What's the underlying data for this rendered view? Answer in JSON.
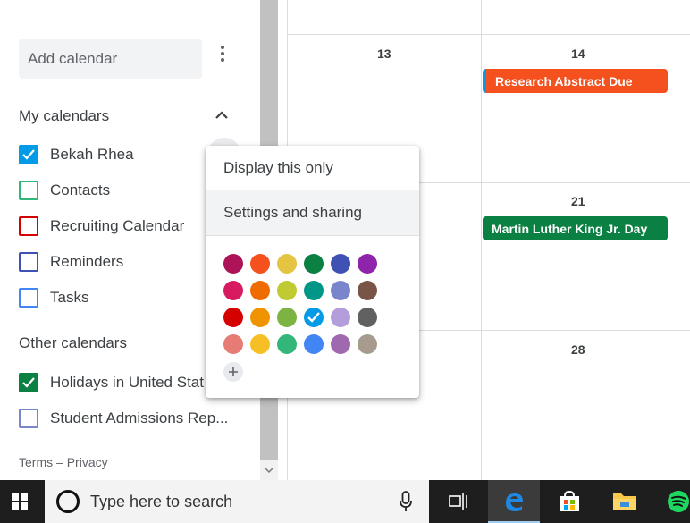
{
  "sidebar": {
    "add_calendar_placeholder": "Add calendar",
    "my_calendars_title": "My calendars",
    "my_calendars": [
      {
        "label": "Bekah Rhea",
        "color": "#039be5",
        "checked": true
      },
      {
        "label": "Contacts",
        "color": "#33b679",
        "checked": false
      },
      {
        "label": "Recruiting Calendar",
        "color": "#d50000",
        "checked": false
      },
      {
        "label": "Reminders",
        "color": "#3f51b5",
        "checked": false
      },
      {
        "label": "Tasks",
        "color": "#4285f4",
        "checked": false
      }
    ],
    "other_calendars_title": "Other calendars",
    "other_calendars": [
      {
        "label": "Holidays in United Stat",
        "color": "#0b8043",
        "checked": true
      },
      {
        "label": "Student Admissions Rep...",
        "color": "#7986cb",
        "checked": false
      }
    ],
    "footer_terms": "Terms",
    "footer_sep": "–",
    "footer_privacy": "Privacy"
  },
  "calendar": {
    "days": [
      {
        "num": "13"
      },
      {
        "num": "14"
      },
      {
        "num": "21"
      },
      {
        "num": "28"
      }
    ],
    "events": [
      {
        "title": "Research Abstract Due",
        "color": "#f4511e",
        "stripe": "#039be5"
      },
      {
        "title": "Martin Luther King Jr. Day",
        "color": "#0b8043"
      }
    ]
  },
  "popup": {
    "items": [
      {
        "label": "Display this only"
      },
      {
        "label": "Settings and sharing"
      }
    ],
    "colors": [
      [
        "#ad1457",
        "#f4511e",
        "#e4c441",
        "#0b8043",
        "#3f51b5",
        "#8e24aa"
      ],
      [
        "#d81b60",
        "#ef6c00",
        "#c0ca33",
        "#009688",
        "#7986cb",
        "#795548"
      ],
      [
        "#d50000",
        "#f09300",
        "#7cb342",
        "#039be5",
        "#b39ddb",
        "#616161"
      ],
      [
        "#e67c73",
        "#f6bf26",
        "#33b679",
        "#4285f4",
        "#9e69af",
        "#a79b8e"
      ]
    ],
    "selected_color": "#039be5",
    "add_color_icon": "plus-icon"
  },
  "taskbar": {
    "search_placeholder": "Type here to search",
    "icons": [
      "windows-icon",
      "cortana-icon",
      "microphone-icon",
      "task-view-icon",
      "edge-icon",
      "store-icon",
      "file-explorer-icon",
      "spotify-icon"
    ]
  }
}
